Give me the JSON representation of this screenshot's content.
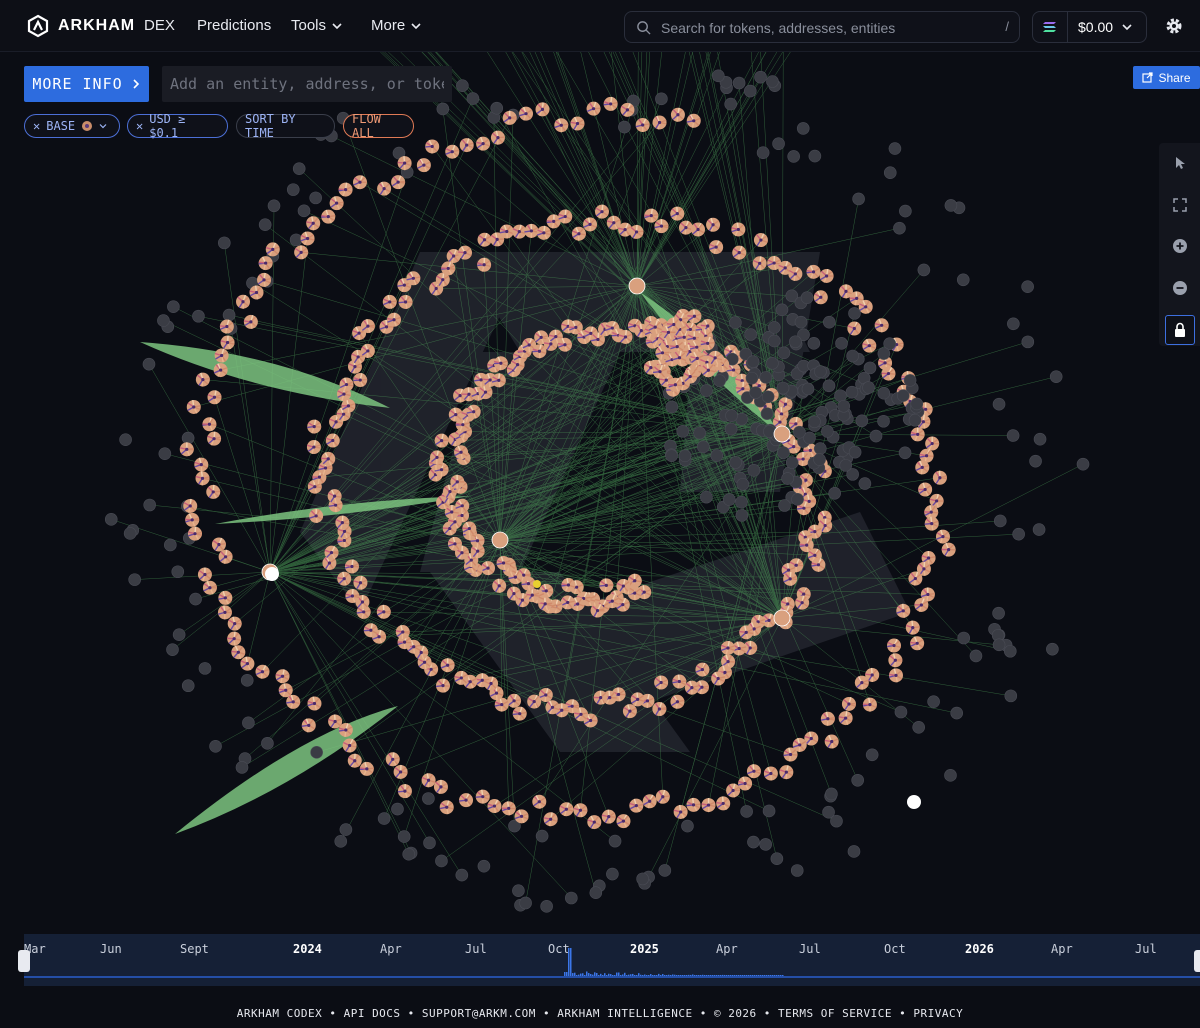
{
  "brand": {
    "name": "ARKHAM"
  },
  "nav": {
    "items": [
      {
        "label": "DEX"
      },
      {
        "label": "Predictions"
      },
      {
        "label": "Tools"
      },
      {
        "label": "More"
      }
    ]
  },
  "search": {
    "placeholder": "Search for tokens, addresses, entities",
    "shortcut": "/"
  },
  "wallet": {
    "balance": "$0.00"
  },
  "controls": {
    "more_info_label": "MORE INFO",
    "entity_placeholder": "Add an entity, address, or token",
    "share_label": "Share"
  },
  "filters": [
    {
      "label": "BASE"
    },
    {
      "label": "USD ≥ $0.1"
    },
    {
      "label": "SORT BY TIME"
    },
    {
      "label": "FLOW ALL"
    }
  ],
  "timeline": {
    "labels": [
      {
        "text": "Mar",
        "year": false
      },
      {
        "text": "Jun",
        "year": false
      },
      {
        "text": "Sept",
        "year": false
      },
      {
        "text": "2024",
        "year": true
      },
      {
        "text": "Apr",
        "year": false
      },
      {
        "text": "Jul",
        "year": false
      },
      {
        "text": "Oct",
        "year": false
      },
      {
        "text": "2025",
        "year": true
      },
      {
        "text": "Apr",
        "year": false
      },
      {
        "text": "Jul",
        "year": false
      },
      {
        "text": "Oct",
        "year": false
      },
      {
        "text": "2026",
        "year": true
      },
      {
        "text": "Apr",
        "year": false
      },
      {
        "text": "Jul",
        "year": false
      }
    ]
  },
  "footer": {
    "text": "ARKHAM CODEX • API DOCS • SUPPORT@ARKM.COM • ARKHAM INTELLIGENCE • © 2026 • TERMS OF SERVICE • PRIVACY"
  },
  "colors": {
    "accent": "#2d6cdf",
    "edge": "#4fa35a",
    "flow_fill": "#7cc47f",
    "node_dark": "#3a3c44",
    "chip_orange": "#e07a55"
  }
}
